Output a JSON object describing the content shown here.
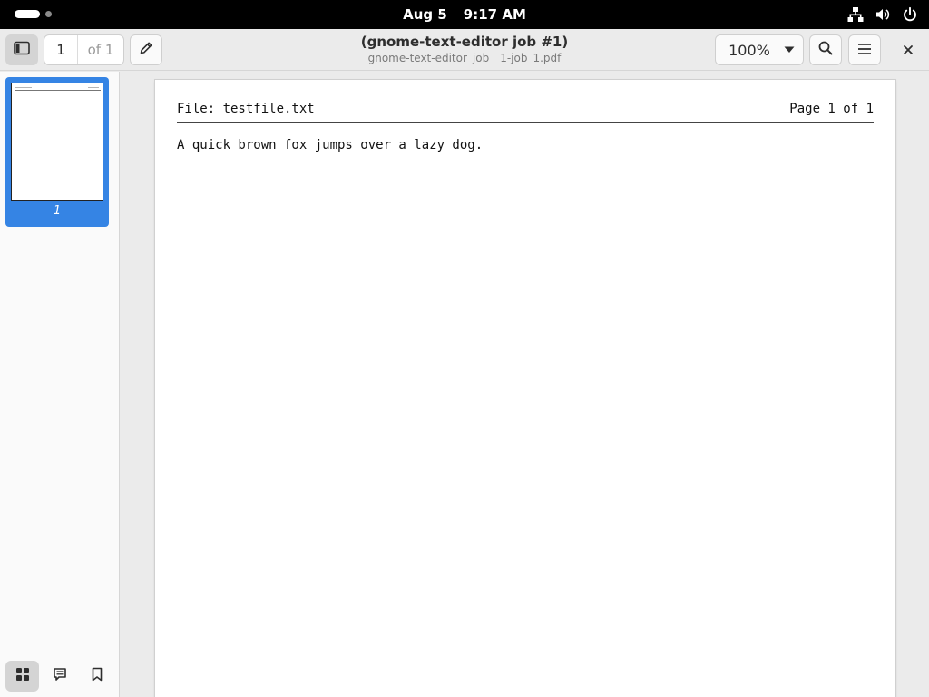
{
  "system_bar": {
    "date": "Aug 5",
    "time": "9:17 AM",
    "icons": [
      "network-icon",
      "volume-icon",
      "power-icon"
    ]
  },
  "header": {
    "title": "(gnome-text-editor job #1)",
    "subtitle": "gnome-text-editor_job__1-job_1.pdf",
    "page_current": "1",
    "page_total": "of 1",
    "zoom": "100%"
  },
  "sidebar": {
    "thumbnails": [
      {
        "label": "1",
        "selected": true
      }
    ],
    "switcher": [
      "thumbnails-icon",
      "annotations-icon",
      "bookmarks-icon"
    ]
  },
  "document": {
    "header_left": "File: testfile.txt",
    "header_right": "Page 1 of 1",
    "body": "A quick brown fox jumps over a lazy dog."
  },
  "colors": {
    "accent": "#3584e4",
    "topbar": "#000000"
  }
}
